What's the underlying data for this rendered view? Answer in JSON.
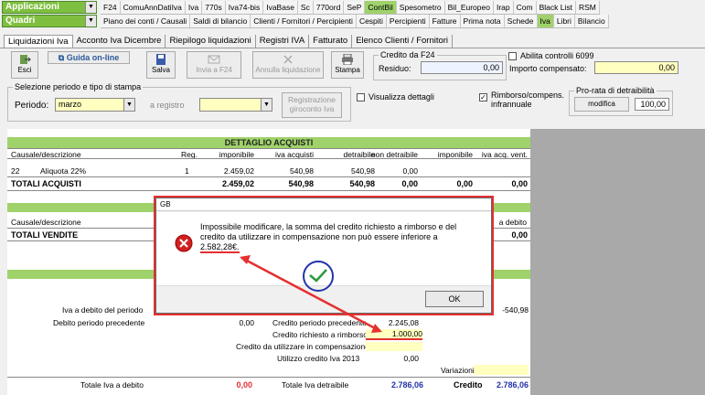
{
  "top": {
    "dropdown1": "Applicazioni",
    "dropdown2": "Quadri",
    "menu1": [
      "F24",
      "ComuAnnDatiIva",
      "Iva",
      "770s",
      "Iva74-bis",
      "IvaBase",
      "Sc",
      "770ord",
      "SeP",
      "ContBil",
      "Spesometro",
      "Bil_Europeo",
      "Irap",
      "Com",
      "Black List",
      "RSM"
    ],
    "menu1_active": 9,
    "menu2": [
      "Piano dei conti / Causali",
      "Saldi di bilancio",
      "Clienti / Fornitori / Percipienti",
      "Cespiti",
      "Percipienti",
      "Fatture",
      "Prima nota",
      "Schede",
      "Iva",
      "Libri",
      "Bilancio"
    ],
    "menu2_active": 8
  },
  "tabs": [
    "Liquidazioni Iva",
    "Acconto Iva Dicembre",
    "Riepilogo liquidazioni",
    "Registri IVA",
    "Fatturato",
    "Elenco Clienti / Fornitori"
  ],
  "toolbar": {
    "esci": "Esci",
    "guida": "Guida on-line",
    "salva": "Salva",
    "invia": "Invia a F24",
    "annulla": "Annulla liquidazione",
    "stampa": "Stampa"
  },
  "credito_f24": {
    "title": "Credito da F24",
    "residuo_label": "Residuo:",
    "residuo_value": "0,00",
    "abilita_label": "Abilita controlli 6099",
    "importo_label": "Importo compensato:",
    "importo_value": "0,00"
  },
  "selezione": {
    "title": "Selezione periodo e tipo di stampa",
    "periodo_label": "Periodo:",
    "periodo_value": "marzo",
    "registro_label": "a registro",
    "registrazione_btn1": "Registrazione",
    "registrazione_btn2": "giroconto Iva",
    "visualizza_label": "Visualizza dettagli",
    "rimborso_label1": "Rimborso/compens.",
    "rimborso_label2": "infrannuale",
    "prorata_title": "Pro-rata di detraibilità",
    "modifica_btn": "modifica",
    "prorata_value": "100,00"
  },
  "acquisti": {
    "title": "DETTAGLIO ACQUISTI",
    "headers": [
      "Causale/descrizione",
      "Reg.",
      "imponibile",
      "iva acquisti",
      "detraibile",
      "non detraibile",
      "imponibile",
      "iva acq. vent."
    ],
    "row": {
      "code": "22",
      "desc": "Aliquota 22%",
      "reg": "1",
      "imponibile": "2.459,02",
      "iva": "540,98",
      "detraibile": "540,98",
      "non_detraibile": "0,00"
    },
    "totals": {
      "label": "TOTALI ACQUISTI",
      "imponibile": "2.459,02",
      "iva": "540,98",
      "detraibile": "540,98",
      "non_detraibile": "0,00",
      "imponibile2": "0,00",
      "iva_vent": "0,00"
    }
  },
  "vendite": {
    "header_left": "Causale/descrizione",
    "header_right": "a debito",
    "totals_label": "TOTALI VENDITE",
    "totals_value": "0,00"
  },
  "riepilogo": {
    "iva_debito_label": "Iva a debito del periodo",
    "iva_debito_value": "-540,98",
    "debito_prec_label": "Debito periodo precedente",
    "debito_prec_value": "0,00",
    "credito_prec_label": "Credito periodo precedente",
    "credito_prec_value": "2.245,08",
    "credito_rimborso_label": "Credito richiesto a rimborso",
    "credito_rimborso_value": "1.000,00",
    "credito_compens_label": "Credito da utilizzare in compensazione",
    "utilizzo_label": "Utilizzo credito Iva 2013",
    "utilizzo_value": "0,00",
    "variazioni_label": "Variazioni",
    "tot_debito_label": "Totale Iva a debito",
    "tot_debito_value": "0,00",
    "tot_detraibile_label": "Totale Iva detraibile",
    "tot_detraibile_value": "2.786,06",
    "credito_label": "Credito",
    "credito_value": "2.786,06"
  },
  "dialog": {
    "title": "GB",
    "message": "Impossibile modificare, la somma del credito richiesto a rimborso e del credito da utilizzare in compensazione non può essere inferiore a",
    "amount": "2.582,28€.",
    "ok": "OK"
  },
  "colors": {
    "green": "#9fd26a",
    "red": "#e53030",
    "blue": "#2233aa"
  }
}
